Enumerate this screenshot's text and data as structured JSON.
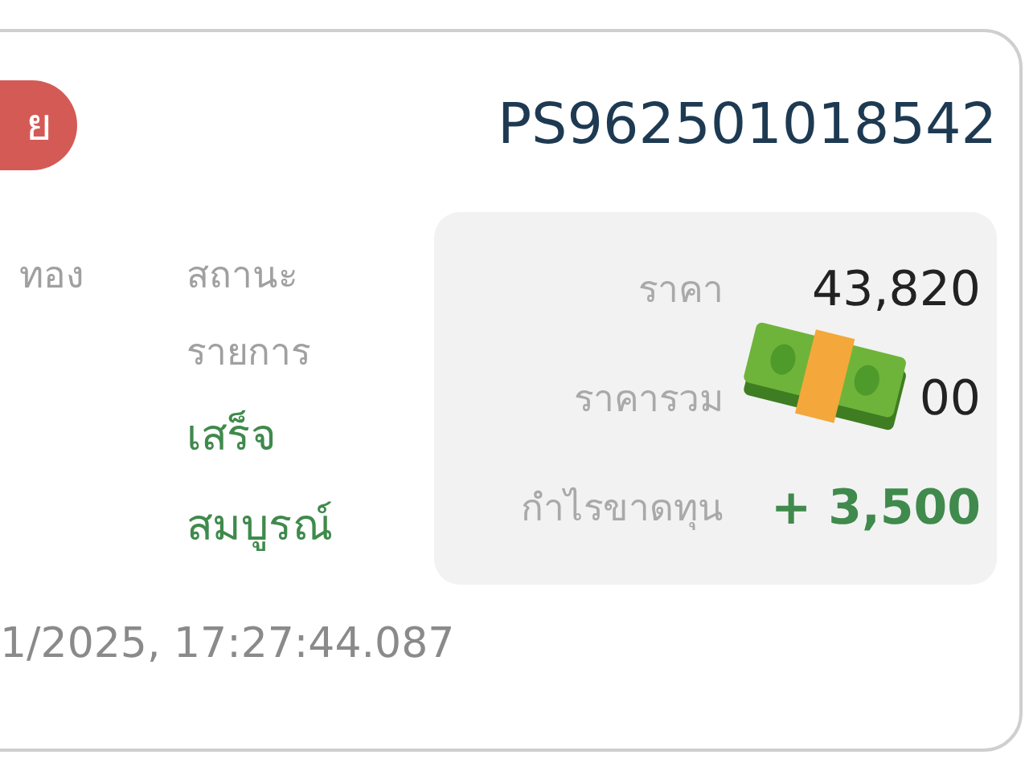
{
  "card": {
    "badge": "ย",
    "order_id": "PS962501018542",
    "type_label": "ทอง",
    "status": {
      "label_lines": [
        "สถานะ",
        "รายการ"
      ],
      "value_lines": [
        "เสร็จ",
        "สมบูรณ์"
      ]
    },
    "summary": [
      {
        "label": "ราคา",
        "value": "43,820",
        "kind": "plain"
      },
      {
        "label": "ราคารวม",
        "value": "00",
        "kind": "plain"
      },
      {
        "label": "กำไรขาดทุน",
        "value": "+ 3,500",
        "kind": "profit"
      }
    ],
    "timestamp": "1/2025, 17:27:44.087"
  }
}
